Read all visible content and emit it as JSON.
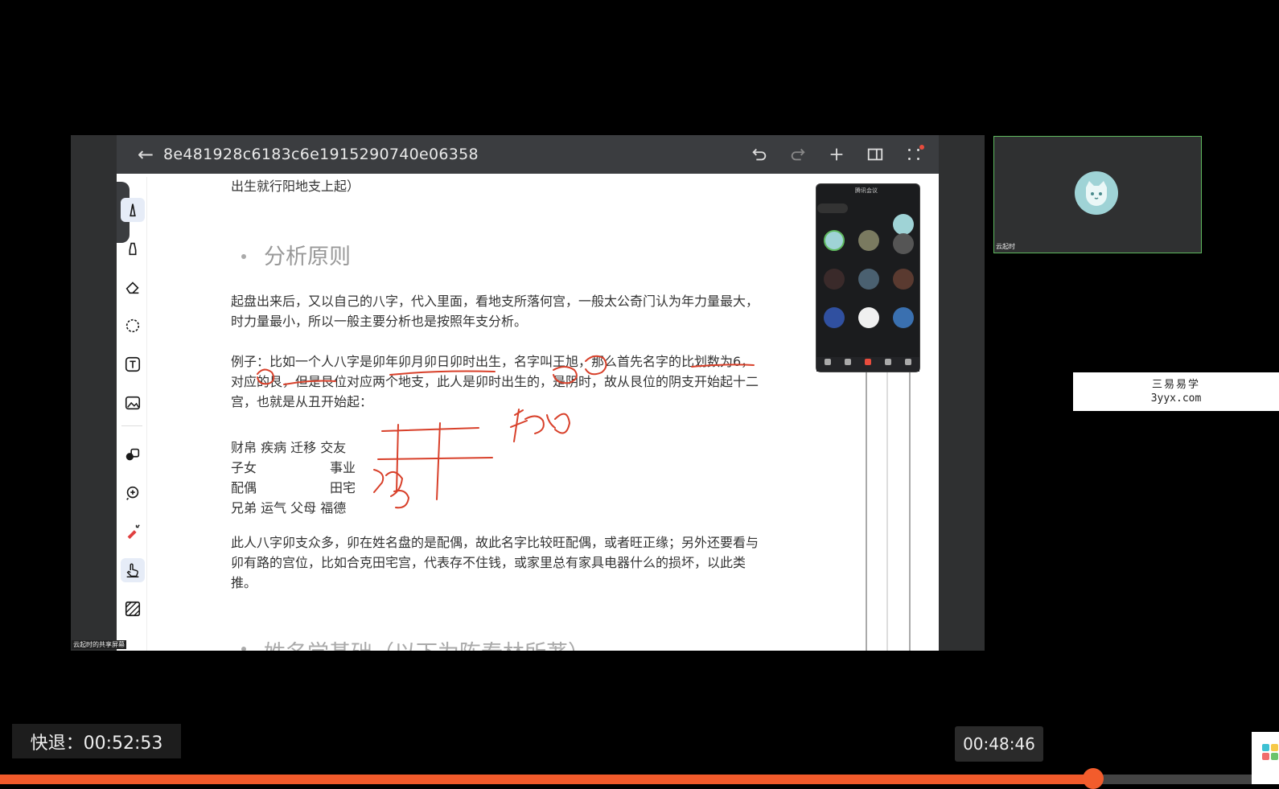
{
  "toolbar": {
    "doc_title": "8e481928c6183c6e1915290740e06358",
    "back_icon": "arrow-left-icon",
    "actions": [
      "undo-icon",
      "redo-icon",
      "plus-icon",
      "split-view-icon",
      "grid-dots-icon"
    ]
  },
  "document": {
    "line_top": "出生就行阳地支上起）",
    "heading1": "分析原则",
    "para1": "起盘出来后，又以自己的八字，代入里面，看地支所落何宫，一般太公奇门认为年力量最大，时力量最小，所以一般主要分析也是按照年支分析。",
    "para2": "例子：比如一个人八字是卯年卯月卯日卯时出生，名字叫王旭，那么首先名字的比划数为6，对应的艮，但是艮位对应两个地支，此人是卯时出生的，是阴时，故从艮位的阴支开始起十二宫，也就是从丑开始起：",
    "palace_grid": {
      "row1": "财帛 疾病 迁移 交友",
      "row2_left": "子女",
      "row2_right": "事业",
      "row3_left": "配偶",
      "row3_right": "田宅",
      "row4": "兄弟 运气 父母 福德"
    },
    "para3": "此人八字卯支众多，卯在姓名盘的是配偶，故此名字比较旺配偶，或者旺正缘；另外还要看与卯有路的宫位，比如合克田宅宫，代表存不住钱，或家里总有家具电器什么的损坏，以此类推。",
    "heading2": "姓名学基础（以下为陈春林所著）"
  },
  "labels": {
    "share_label": "云起时的共享屏幕",
    "self_name": "云起时",
    "phone_title": "腾讯会议"
  },
  "watermark": {
    "cn": "三易易学",
    "en": "3yyx.com"
  },
  "player": {
    "rewind": "快退：00:52:53",
    "current_time": "00:48:46",
    "progress": 0.855,
    "accent": "#f15a2b"
  }
}
